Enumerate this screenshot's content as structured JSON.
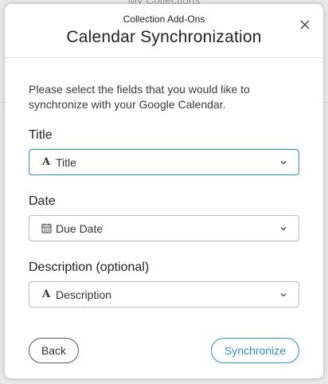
{
  "background": {
    "title": "My Collections"
  },
  "modal": {
    "subtitle": "Collection Add-Ons",
    "title": "Calendar Synchronization",
    "instructions": "Please select the fields that you would like to synchronize with your Google Calendar.",
    "fields": [
      {
        "label": "Title",
        "value": "Title",
        "icon": "text-field-icon"
      },
      {
        "label": "Date",
        "value": "Due Date",
        "icon": "calendar-icon"
      },
      {
        "label": "Description (optional)",
        "value": "Description",
        "icon": "text-field-icon"
      }
    ],
    "buttons": {
      "back": "Back",
      "synchronize": "Synchronize"
    }
  },
  "colors": {
    "accent": "#2f8fbd",
    "text": "#222222",
    "border": "#bdbdbd"
  }
}
